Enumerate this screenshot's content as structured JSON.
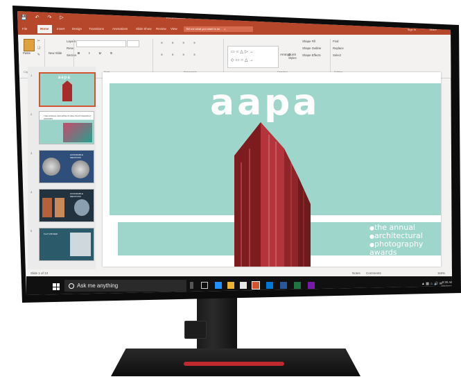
{
  "titlebar": {
    "doc_title": "Presentation1 - Microsoft PowerPoint Preview",
    "qat_icons": [
      "save-icon",
      "undo-icon",
      "redo-icon",
      "present-icon"
    ],
    "window_controls": [
      "minimize-icon",
      "restore-icon",
      "close-icon"
    ]
  },
  "ribbon_tabs": [
    "File",
    "Home",
    "Insert",
    "Design",
    "Transitions",
    "Animations",
    "Slide Show",
    "Review",
    "View"
  ],
  "tell_me": "Tell me what you want to do",
  "sign_in": "Sign in",
  "share": "Share",
  "ribbon": {
    "paste": "Paste",
    "new_slide": "New Slide",
    "layout": "Layout",
    "reset": "Reset",
    "section": "Section",
    "groups": [
      "Clipboard",
      "Slides",
      "Font",
      "Paragraph",
      "Drawing",
      "Editing"
    ],
    "arrange": "Arrange",
    "quick_styles": "Quick Styles",
    "shape_fill": "Shape Fill",
    "shape_outline": "Shape Outline",
    "shape_effects": "Shape Effects",
    "find": "Find",
    "replace": "Replace",
    "select": "Select"
  },
  "thumbnails": [
    {
      "num": "1",
      "title": "aapa"
    },
    {
      "num": "2",
      "title": "THE ANNUAL ARCHITECTURAL PHOTOGRAPHY AWARDS"
    },
    {
      "num": "3",
      "title": "HONORABLE MENTIONS"
    },
    {
      "num": "4",
      "title": "HONORABLE MENTIONS"
    },
    {
      "num": "5",
      "title": "FLAT WINNER"
    }
  ],
  "slide": {
    "logo": "aapa",
    "tagline": [
      "the annual",
      "architectural",
      "photography awards"
    ]
  },
  "status": {
    "slide_of": "Slide 1 of 13",
    "notes": "Notes",
    "comments": "Comments",
    "zoom": "116%"
  },
  "taskbar": {
    "search_placeholder": "Ask me anything",
    "time": "8:30 AM",
    "date": "6/5/2019"
  },
  "colors": {
    "accent": "#b7472a",
    "slide_teal": "#9fd6cc",
    "building_red": "#a72b2b",
    "stand_accent": "#c0282f"
  }
}
